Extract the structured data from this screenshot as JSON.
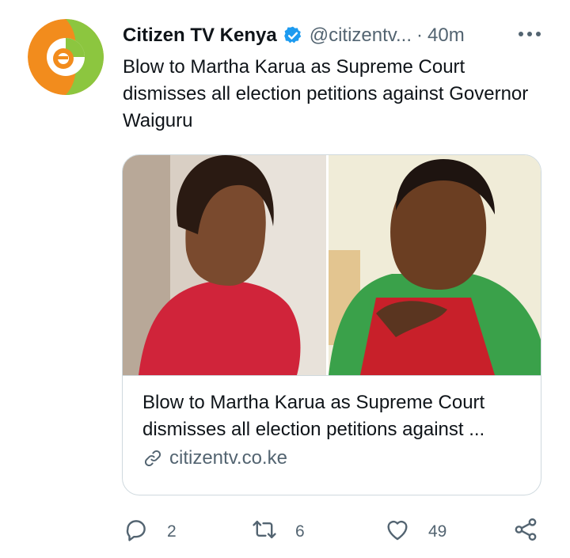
{
  "tweet": {
    "author_name": "Citizen TV Kenya",
    "handle": "@citizentv...",
    "separator": "·",
    "time": "40m",
    "text": "Blow to Martha Karua as Supreme Court dismisses all election petitions against Governor Waiguru"
  },
  "card": {
    "title": "Blow to Martha Karua as Supreme Court dismisses all election petitions against ...",
    "domain": "citizentv.co.ke"
  },
  "actions": {
    "replies": "2",
    "retweets": "6",
    "likes": "49"
  },
  "icons": {
    "avatar": "citizen-tv-logo",
    "verified": "verified-badge-icon",
    "more": "more-icon",
    "link": "link-icon",
    "reply": "reply-icon",
    "retweet": "retweet-icon",
    "like": "heart-icon",
    "share": "share-icon"
  },
  "colors": {
    "text": "#0f1419",
    "secondary": "#536471",
    "border": "#cfd9de",
    "verified": "#1d9bf0",
    "logo_orange": "#f28c1d",
    "logo_green": "#8cc63f"
  }
}
